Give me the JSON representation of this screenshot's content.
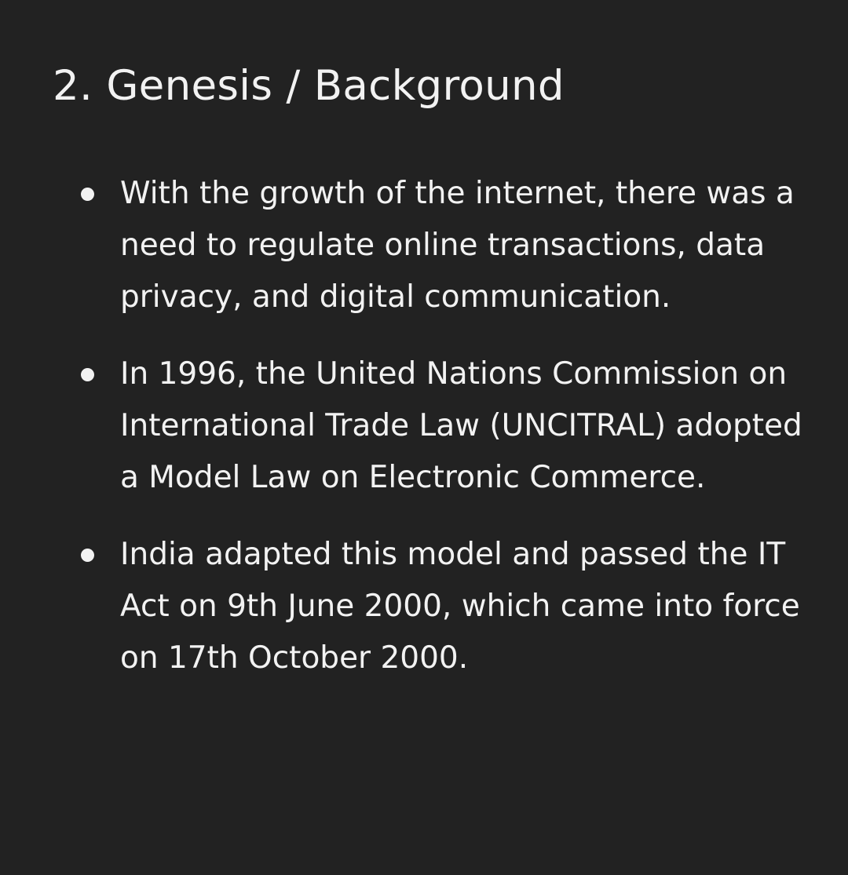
{
  "section": {
    "heading": "2. Genesis / Background",
    "bullets": [
      {
        "text_1": "With the growth of the ",
        "emph_1": "internet",
        "text_2": ", there was a need to regulate online transactions, data privacy, and digital communication."
      },
      {
        "text_1": "In 1996, the ",
        "emph_1": "United Nations Commission on International Trade Law (UNCITRAL)",
        "text_2": " adopted a ",
        "emph_2": "Model Law on Electronic Commerce",
        "text_3": "."
      },
      {
        "text_1": "India adapted this model and passed the ",
        "emph_1": "IT Act on 9th June 2000",
        "text_2": ", which came into force on ",
        "emph_2": "17th October 2000",
        "text_3": "."
      }
    ]
  }
}
